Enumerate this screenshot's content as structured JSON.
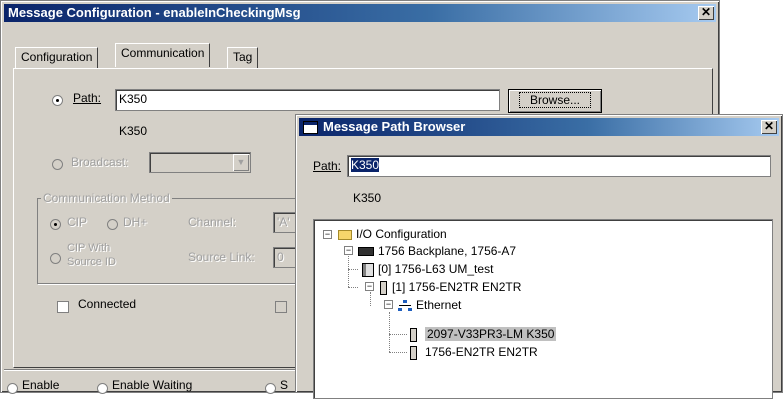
{
  "main_dialog": {
    "title": "Message Configuration - enableInCheckingMsg",
    "tabs": [
      "Configuration",
      "Communication",
      "Tag"
    ],
    "path_label": "Path:",
    "path_value": "K350",
    "path_resolved": "K350",
    "browse_label": "Browse...",
    "broadcast_label": "Broadcast:",
    "comm_method_legend": "Communication Method",
    "cip_label": "CIP",
    "dhplus_label": "DH+",
    "channel_label": "Channel:",
    "channel_value": "'A'",
    "cip_source_label_1": "CIP With",
    "cip_source_label_2": "Source ID",
    "source_link_label": "Source Link:",
    "source_link_value": "0",
    "connected_label": "Connected",
    "status": [
      "Enable",
      "Enable Waiting",
      "S"
    ]
  },
  "browser_dialog": {
    "title": "Message Path Browser",
    "path_label": "Path:",
    "path_value": "K350",
    "path_resolved": "K350",
    "tree": [
      {
        "label": "I/O Configuration",
        "icon": "folder-icon",
        "level": 0
      },
      {
        "label": "1756 Backplane, 1756-A7",
        "icon": "backplane-icon",
        "level": 1
      },
      {
        "label": "[0] 1756-L63 UM_test",
        "icon": "controller-icon",
        "level": 2
      },
      {
        "label": "[1] 1756-EN2TR EN2TR",
        "icon": "module-icon",
        "level": 2
      },
      {
        "label": "Ethernet",
        "icon": "network-icon",
        "level": 3
      },
      {
        "label": "2097-V33PR3-LM K350",
        "icon": "module-icon",
        "level": 4,
        "selected": true
      },
      {
        "label": "1756-EN2TR EN2TR",
        "icon": "module-icon",
        "level": 4
      }
    ]
  }
}
